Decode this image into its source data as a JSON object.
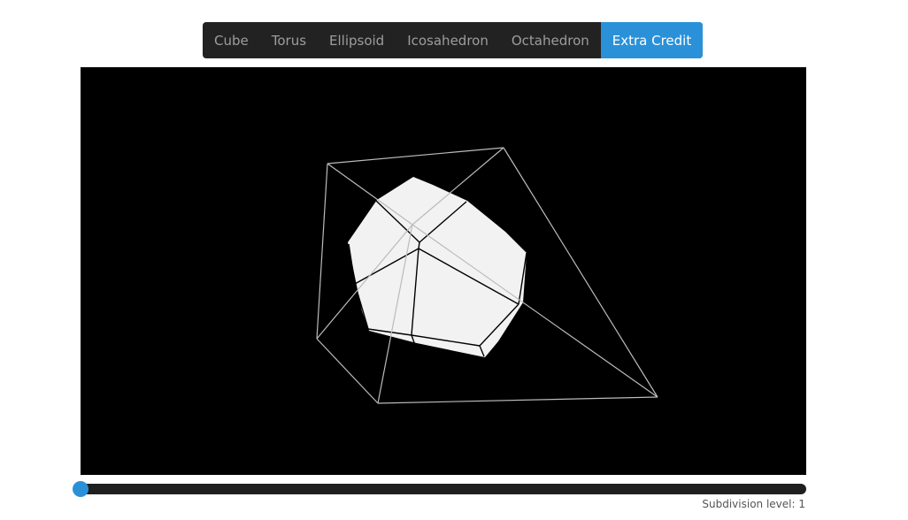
{
  "nav": {
    "tabs": [
      {
        "label": "Cube",
        "active": false
      },
      {
        "label": "Torus",
        "active": false
      },
      {
        "label": "Ellipsoid",
        "active": false
      },
      {
        "label": "Icosahedron",
        "active": false
      },
      {
        "label": "Octahedron",
        "active": false
      },
      {
        "label": "Extra Credit",
        "active": true
      }
    ]
  },
  "viewport": {
    "background": "#000000",
    "mesh_fill": "#f2f2f2",
    "mesh_edge": "#000000",
    "cage_edge": "#bbbbbb"
  },
  "subdivision": {
    "label": "Subdivision level: 1",
    "level": 1
  },
  "colors": {
    "accent": "#2a91d8",
    "tab_bar": "#222222",
    "tab_text": "#9d9d9d"
  }
}
